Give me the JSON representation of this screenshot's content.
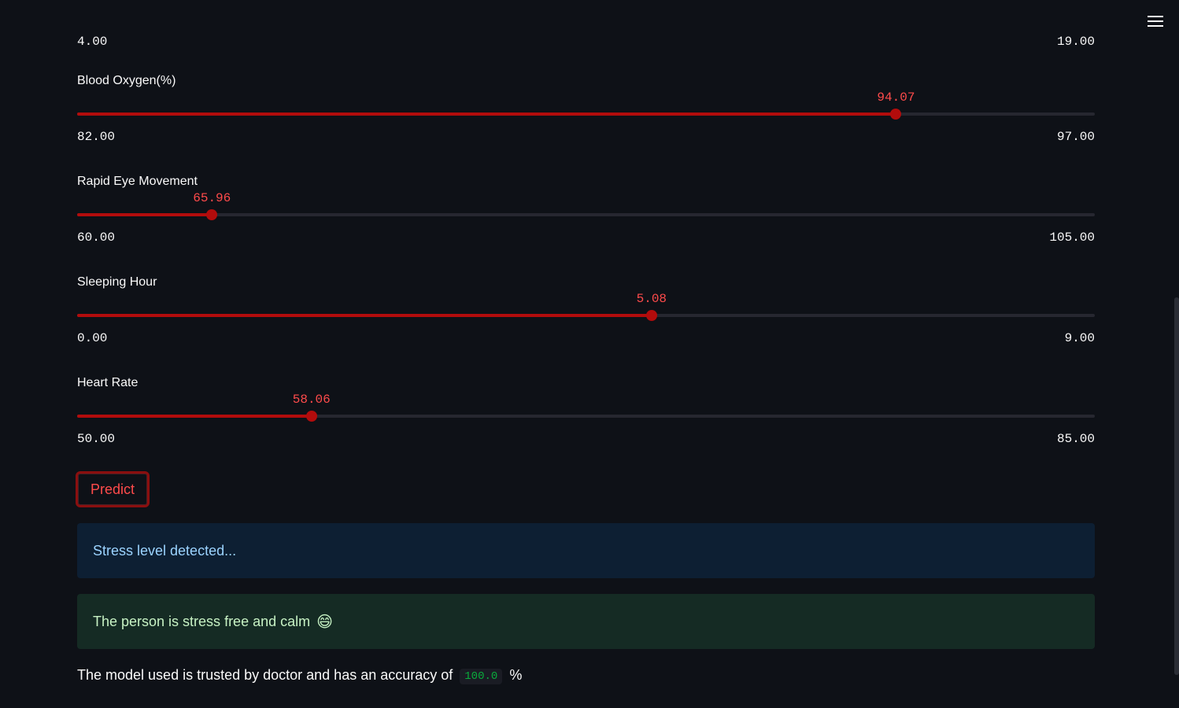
{
  "colors": {
    "background": "#0e1117",
    "accent": "#ff4b4b",
    "slider_fill": "#b20c0c",
    "info_bg": "#0d1f33",
    "success_bg": "#152b24"
  },
  "header": {
    "menu_icon": "hamburger-menu-icon"
  },
  "partial_slider": {
    "min_label": "4.00",
    "max_label": "19.00"
  },
  "sliders": [
    {
      "label": "Blood Oxygen(%)",
      "min": 82.0,
      "max": 97.0,
      "value": 94.07,
      "min_label": "82.00",
      "max_label": "97.00",
      "value_label": "94.07"
    },
    {
      "label": "Rapid Eye Movement",
      "min": 60.0,
      "max": 105.0,
      "value": 65.96,
      "min_label": "60.00",
      "max_label": "105.00",
      "value_label": "65.96"
    },
    {
      "label": "Sleeping Hour",
      "min": 0.0,
      "max": 9.0,
      "value": 5.08,
      "min_label": "0.00",
      "max_label": "9.00",
      "value_label": "5.08"
    },
    {
      "label": "Heart Rate",
      "min": 50.0,
      "max": 85.0,
      "value": 58.06,
      "min_label": "50.00",
      "max_label": "85.00",
      "value_label": "58.06"
    }
  ],
  "predict_button": {
    "label": "Predict"
  },
  "info_alert": {
    "text": "Stress level detected..."
  },
  "success_alert": {
    "text": "The person is stress free and calm",
    "emoji": "😄"
  },
  "accuracy": {
    "prefix": "The model used is trusted by doctor and has an accuracy of",
    "value": "100.0",
    "suffix": "%"
  }
}
